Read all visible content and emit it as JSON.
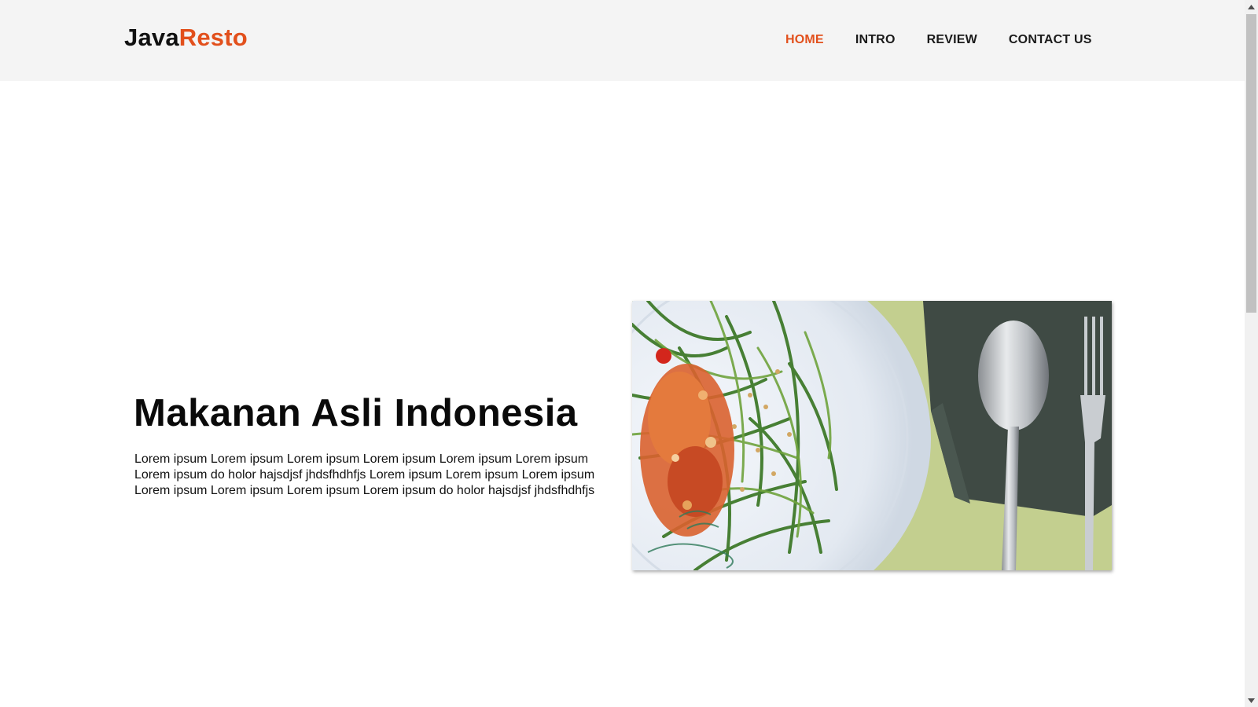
{
  "brand": {
    "name_part1": "Java",
    "name_part2": "Resto",
    "accent_color": "#e2501c"
  },
  "nav": {
    "items": [
      {
        "label": "HOME",
        "active": true
      },
      {
        "label": "INTRO",
        "active": false
      },
      {
        "label": "REVIEW",
        "active": false
      },
      {
        "label": "CONTACT US",
        "active": false
      }
    ]
  },
  "hero": {
    "title": "Makanan Asli Indonesia",
    "lines": [
      "Lorem ipsum Lorem ipsum Lorem ipsum Lorem ipsum Lorem ipsum Lorem ipsum",
      "Lorem ipsum do holor hajsdjsf jhdsfhdhfjs Lorem ipsum Lorem ipsum Lorem ipsum",
      "Lorem ipsum Lorem ipsum Lorem ipsum Lorem ipsum do holor hajsdjsf jhdsfhdhfjs"
    ],
    "image": "plate-of-stir-fried-water-spinach-with-sambal-spoon-and-fork"
  },
  "scrollbar": {
    "up_icon": "scroll-up-arrow-icon",
    "down_icon": "scroll-down-arrow-icon"
  }
}
